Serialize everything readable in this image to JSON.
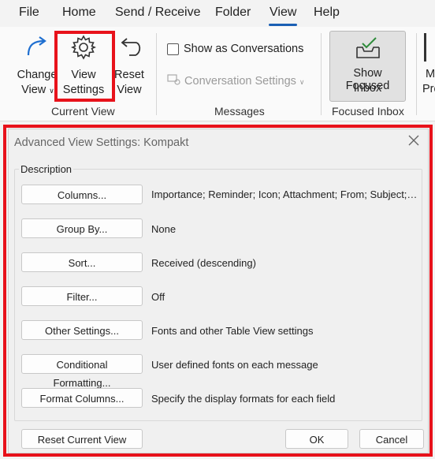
{
  "menu": {
    "items": [
      {
        "label": "File"
      },
      {
        "label": "Home"
      },
      {
        "label": "Send / Receive"
      },
      {
        "label": "Folder"
      },
      {
        "label": "View"
      },
      {
        "label": "Help"
      }
    ],
    "active": "View"
  },
  "ribbon": {
    "change_view": {
      "line1": "Change",
      "line2": "View"
    },
    "view_settings": {
      "line1": "View",
      "line2": "Settings"
    },
    "reset_view": {
      "line1": "Reset",
      "line2": "View"
    },
    "current_view_label": "Current View",
    "show_as_conversations": "Show as Conversations",
    "conversation_settings": "Conversation Settings",
    "messages_label": "Messages",
    "show_focused_inbox": {
      "line1": "Show Focused",
      "line2": "Inbox"
    },
    "focused_inbox_label": "Focused Inbox",
    "partial_right": {
      "line1": "M",
      "line2": "Pre"
    }
  },
  "dialog": {
    "title": "Advanced View Settings: Kompakt",
    "group_caption": "Description",
    "rows": [
      {
        "button": "Columns...",
        "desc": "Importance; Reminder; Icon; Attachment; From; Subject; Re..."
      },
      {
        "button": "Group By...",
        "desc": "None"
      },
      {
        "button": "Sort...",
        "desc": "Received (descending)"
      },
      {
        "button": "Filter...",
        "desc": "Off"
      },
      {
        "button": "Other Settings...",
        "desc": "Fonts and other Table View settings"
      },
      {
        "button": "Conditional Formatting...",
        "desc": "User defined fonts on each message"
      },
      {
        "button": "Format Columns...",
        "desc": "Specify the display formats for each field"
      }
    ],
    "reset_button": "Reset Current View",
    "ok_button": "OK",
    "cancel_button": "Cancel"
  },
  "colors": {
    "highlight": "#e8121b",
    "accent": "#1a5fb4"
  }
}
